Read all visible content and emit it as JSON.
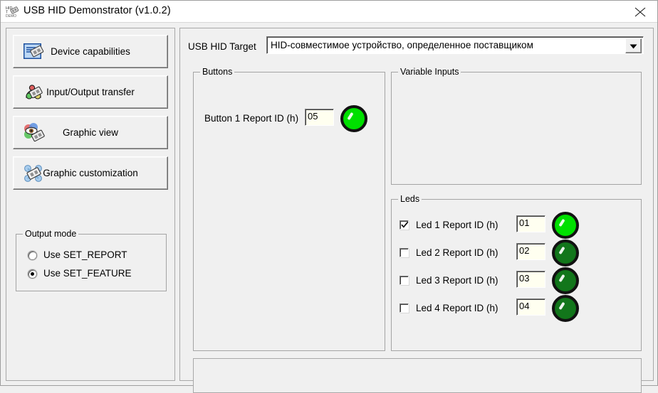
{
  "window": {
    "title": "USB HID Demonstrator (v1.0.2)",
    "app_icon": "usb-hid-demo-icon",
    "close_label": "✕"
  },
  "sidebar": {
    "buttons": [
      {
        "label": "Device capabilities",
        "icon": "device-capabilities-icon"
      },
      {
        "label": "Input/Output transfer",
        "icon": "input-output-transfer-icon"
      },
      {
        "label": "Graphic view",
        "icon": "graphic-view-icon"
      },
      {
        "label": "Graphic customization",
        "icon": "graphic-customization-icon"
      }
    ],
    "output_mode": {
      "title": "Output mode",
      "options": [
        {
          "label": "Use SET_REPORT",
          "selected": false
        },
        {
          "label": "Use SET_FEATURE",
          "selected": true
        }
      ]
    }
  },
  "target": {
    "label": "USB HID Target",
    "selected": "HID-совместимое устройство, определенное поставщиком"
  },
  "buttons_group": {
    "title": "Buttons",
    "rows": [
      {
        "label": "Button 1 Report ID (h)",
        "value": "05",
        "led": "on"
      }
    ]
  },
  "variable_inputs": {
    "title": "Variable Inputs",
    "content": ""
  },
  "leds_group": {
    "title": "Leds",
    "rows": [
      {
        "label": "Led 1 Report ID (h)",
        "value": "01",
        "checked": true,
        "led": "on"
      },
      {
        "label": "Led 2 Report ID (h)",
        "value": "02",
        "checked": false,
        "led": "off"
      },
      {
        "label": "Led 3 Report ID (h)",
        "value": "03",
        "checked": false,
        "led": "off"
      },
      {
        "label": "Led 4 Report ID (h)",
        "value": "04",
        "checked": false,
        "led": "off"
      }
    ]
  },
  "status": {
    "text": ""
  },
  "colors": {
    "face": "#f0f0f0",
    "led_on": "#00e000",
    "led_off": "#12761b",
    "field_bg": "#fffff0",
    "titlebar": "#ffffff"
  }
}
